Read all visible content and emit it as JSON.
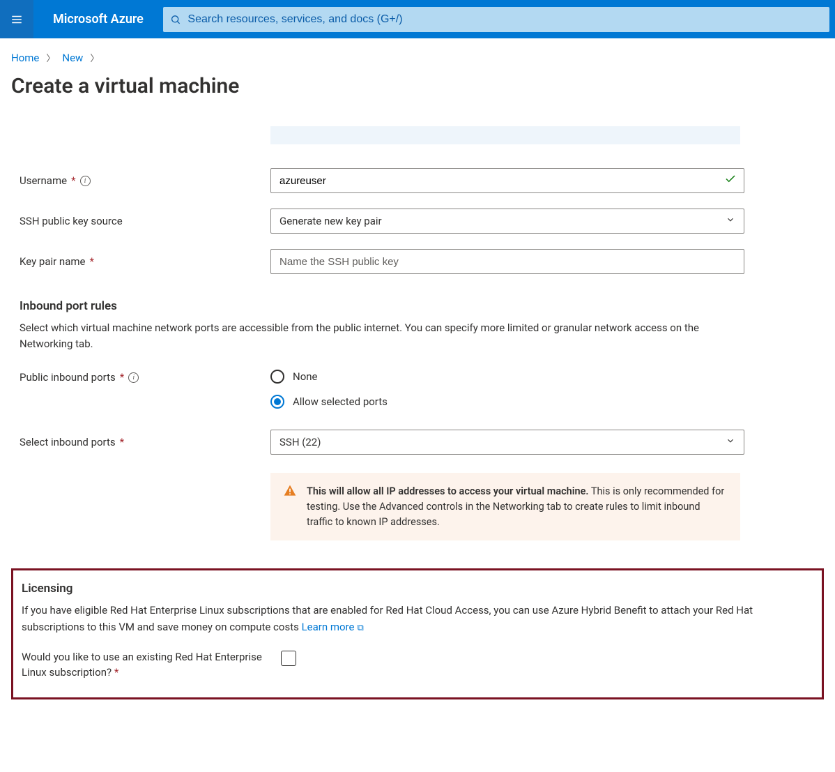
{
  "header": {
    "brand": "Microsoft Azure",
    "search_placeholder": "Search resources, services, and docs (G+/)"
  },
  "breadcrumb": {
    "home": "Home",
    "new": "New"
  },
  "page_title": "Create a virtual machine",
  "form": {
    "username_label": "Username",
    "username_value": "azureuser",
    "ssh_source_label": "SSH public key source",
    "ssh_source_value": "Generate new key pair",
    "keypair_label": "Key pair name",
    "keypair_placeholder": "Name the SSH public key"
  },
  "inbound": {
    "heading": "Inbound port rules",
    "desc": "Select which virtual machine network ports are accessible from the public internet. You can specify more limited or granular network access on the Networking tab.",
    "public_ports_label": "Public inbound ports",
    "radio_none": "None",
    "radio_allow": "Allow selected ports",
    "select_ports_label": "Select inbound ports",
    "select_ports_value": "SSH (22)"
  },
  "callout": {
    "bold": "This will allow all IP addresses to access your virtual machine.",
    "rest": "  This is only recommended for testing.  Use the Advanced controls in the Networking tab to create rules to limit inbound traffic to known IP addresses."
  },
  "licensing": {
    "heading": "Licensing",
    "desc": "If you have eligible Red Hat Enterprise Linux subscriptions that are enabled for Red Hat Cloud Access, you can use Azure Hybrid Benefit to attach your Red Hat subscriptions to this VM and save money on compute costs  ",
    "learn_more": "Learn more",
    "checkbox_label": "Would you like to use an existing Red Hat Enterprise Linux subscription?"
  }
}
